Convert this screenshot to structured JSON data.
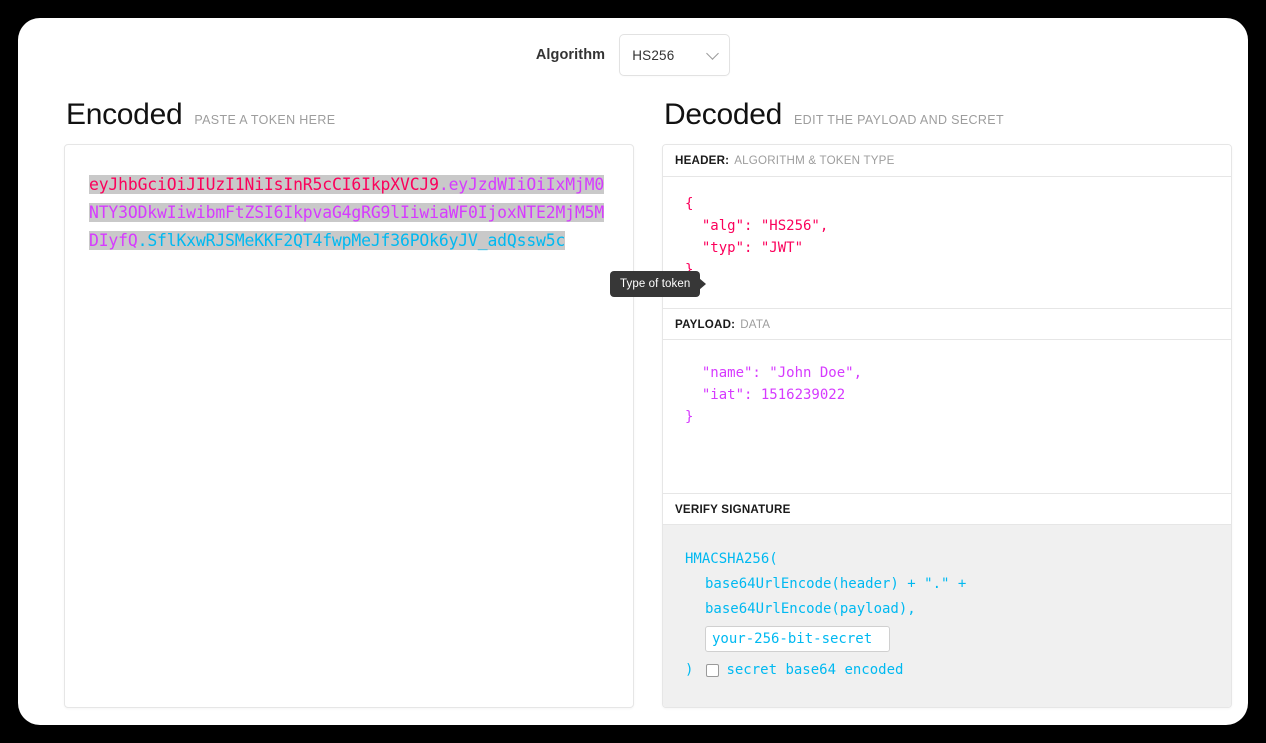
{
  "toolbar": {
    "algorithm_label": "Algorithm",
    "algorithm_value": "HS256",
    "chevron_icon": "chevron-down-icon"
  },
  "encoded": {
    "title": "Encoded",
    "subtitle": "PASTE A TOKEN HERE",
    "token": {
      "header_part": "eyJhbGciOiJIUzI1NiIsInR5cCI6IkpXVCJ9",
      "dot1": ".",
      "payload_part": "eyJzdWIiOiIxMjM0NTY3ODkwIiwibmFtZSI6IkpvaG4gRG9lIiwiaWF0IjoxNTE2MjM5MDIyfQ",
      "dot2": ".",
      "signature_part": "SflKxwRJSMeKKF2QT4fwpMeJf36POk6yJV_adQssw5c"
    },
    "colors": {
      "header": "#fb015b",
      "payload": "#d63aff",
      "signature": "#00b9f1",
      "selection_background": "#c9c9c9"
    }
  },
  "tooltip": {
    "text": "Type of token"
  },
  "decoded": {
    "title": "Decoded",
    "subtitle": "EDIT THE PAYLOAD AND SECRET",
    "sections": {
      "header": {
        "label": "HEADER:",
        "sublabel": "ALGORITHM & TOKEN TYPE",
        "lines": [
          "{",
          "  \"alg\": \"HS256\",",
          "  \"typ\": \"JWT\"",
          "}"
        ]
      },
      "payload": {
        "label": "PAYLOAD:",
        "sublabel": "DATA",
        "lines": [
          "  \"name\": \"John Doe\",",
          "  \"iat\": 1516239022",
          "}"
        ]
      },
      "signature": {
        "label": "VERIFY SIGNATURE",
        "sublabel": "",
        "line1": "HMACSHA256(",
        "line2": "base64UrlEncode(header) + \".\" +",
        "line3": "base64UrlEncode(payload),",
        "secret_value": "your-256-bit-secret",
        "closing_paren": ")",
        "base64_label": "secret base64 encoded",
        "base64_checked": false
      }
    }
  }
}
